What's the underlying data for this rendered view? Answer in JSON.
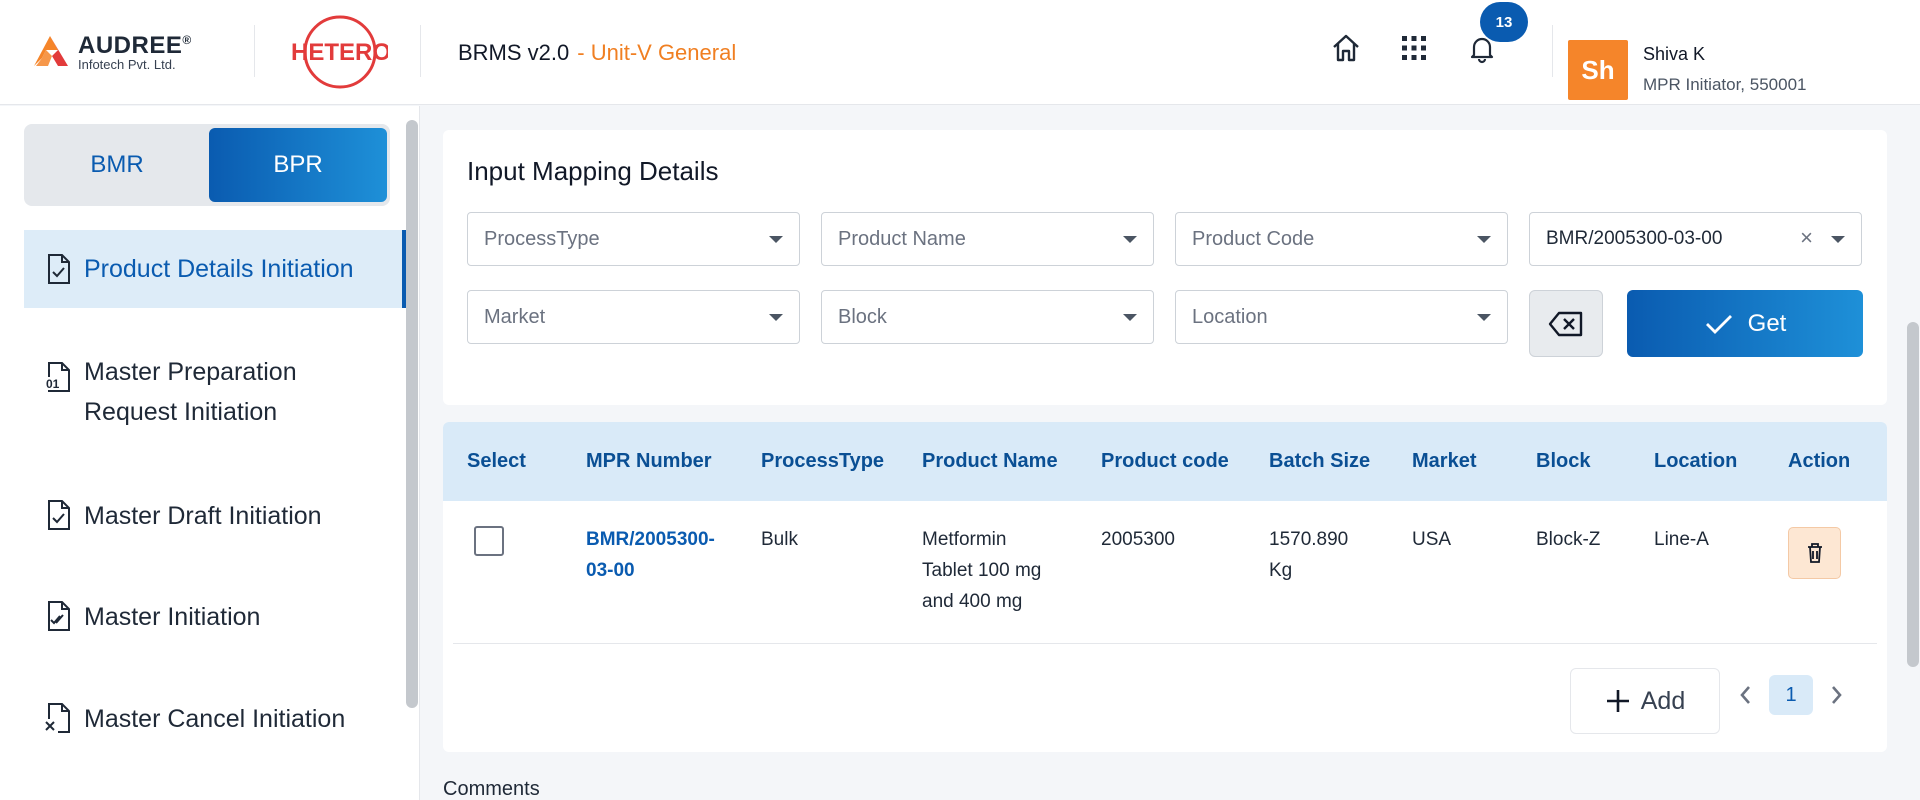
{
  "header": {
    "company_name": "AUDREE",
    "company_reg": "®",
    "company_sub": "Infotech Pvt. Ltd.",
    "partner_logo": "HETERO",
    "app_name": "BRMS v2.0",
    "app_unit": "- Unit-V General",
    "icons": [
      "home-icon",
      "apps-grid-icon",
      "bell-icon"
    ],
    "notification_count": "13",
    "user": {
      "initials": "Sh",
      "name": "Shiva K",
      "role": "MPR Initiator, 550001"
    },
    "accent_color": "#f07f22",
    "primary_color": "#0a5bb0"
  },
  "sidebar": {
    "toggle": {
      "left": "BMR",
      "right": "BPR",
      "selected": "BPR"
    },
    "items": [
      {
        "label": "Product Details Initiation",
        "icon": "file-check-icon",
        "active": true
      },
      {
        "label_line1": "Master Preparation",
        "label_line2": "Request Initiation",
        "icon": "file-binary-icon"
      },
      {
        "label": "Master Draft Initiation",
        "icon": "file-check-icon"
      },
      {
        "label": "Master Initiation",
        "icon": "file-double-check-icon"
      },
      {
        "label": "Master Cancel Initiation",
        "icon": "file-x-icon"
      }
    ]
  },
  "filters": {
    "title": "Input Mapping Details",
    "process_type": "ProcessType",
    "product_name": "Product Name",
    "product_code": "Product Code",
    "mpr_value": "BMR/2005300-03-00",
    "clear_symbol": "×",
    "market": "Market",
    "block": "Block",
    "location": "Location",
    "get_label": "Get"
  },
  "table": {
    "columns": [
      "Select",
      "MPR Number",
      "ProcessType",
      "Product Name",
      "Product code",
      "Batch Size",
      "Market",
      "Block",
      "Location",
      "Action"
    ],
    "rows": [
      {
        "mpr_line1": "BMR/2005300-",
        "mpr_line2": "03-00",
        "process_type": "Bulk",
        "product_line1": "Metformin",
        "product_line2": "Tablet 100 mg",
        "product_line3": "and 400 mg",
        "product_code": "2005300",
        "batch_line1": "1570.890",
        "batch_line2": "Kg",
        "market": "USA",
        "block": "Block-Z",
        "location": "Line-A"
      }
    ],
    "add_label": "Add",
    "page": "1"
  },
  "comments_label": "Comments"
}
